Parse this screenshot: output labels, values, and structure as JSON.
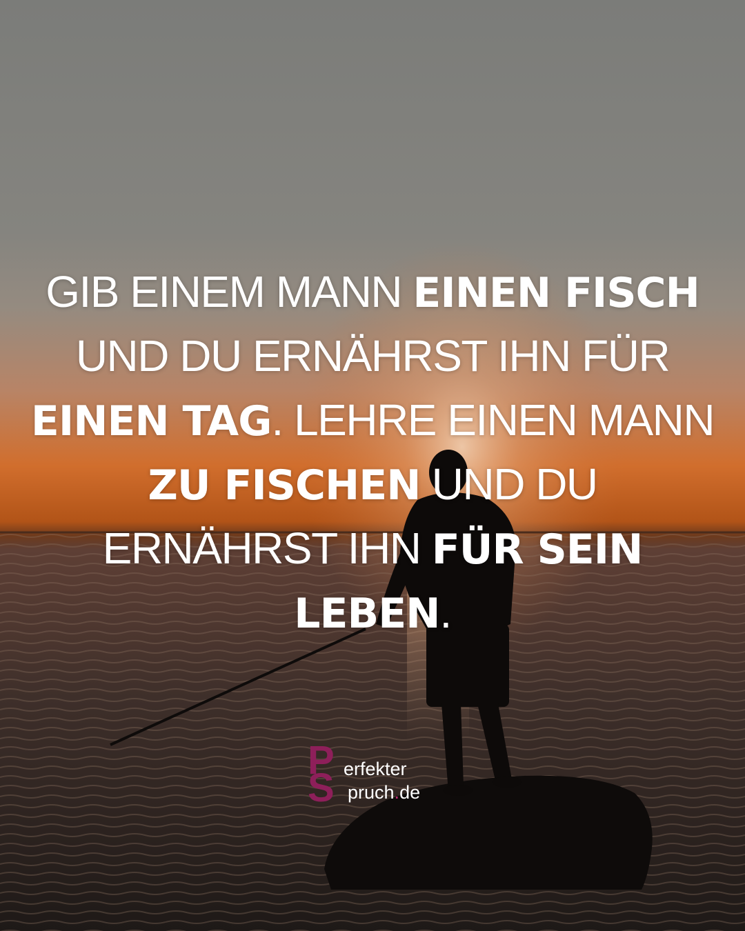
{
  "quote": {
    "segments": [
      {
        "text": "Gib einem Mann ",
        "weight": "light"
      },
      {
        "text": "einen Fisch",
        "weight": "bold"
      },
      {
        "text": " und du ernährst ihn für ",
        "weight": "light"
      },
      {
        "text": "einen Tag",
        "weight": "bold"
      },
      {
        "text": ". Lehre einen Mann ",
        "weight": "light"
      },
      {
        "text": "zu fischen",
        "weight": "bold"
      },
      {
        "text": " und du ernährst ihn ",
        "weight": "light"
      },
      {
        "text": "für sein Leben",
        "weight": "bold"
      },
      {
        "text": ".",
        "weight": "light"
      }
    ]
  },
  "logo": {
    "letter_p": "P",
    "letter_s": "S",
    "line1": "erfekter",
    "line2_main": "pruch",
    "line2_dot": ".",
    "line2_tld": "de",
    "color": "#8e1f5a"
  },
  "colors": {
    "sky_top": "#7c7d7a",
    "sky_mid": "#8f8a82",
    "horizon_glow": "#d8712a",
    "sea": "#3a2a22"
  }
}
